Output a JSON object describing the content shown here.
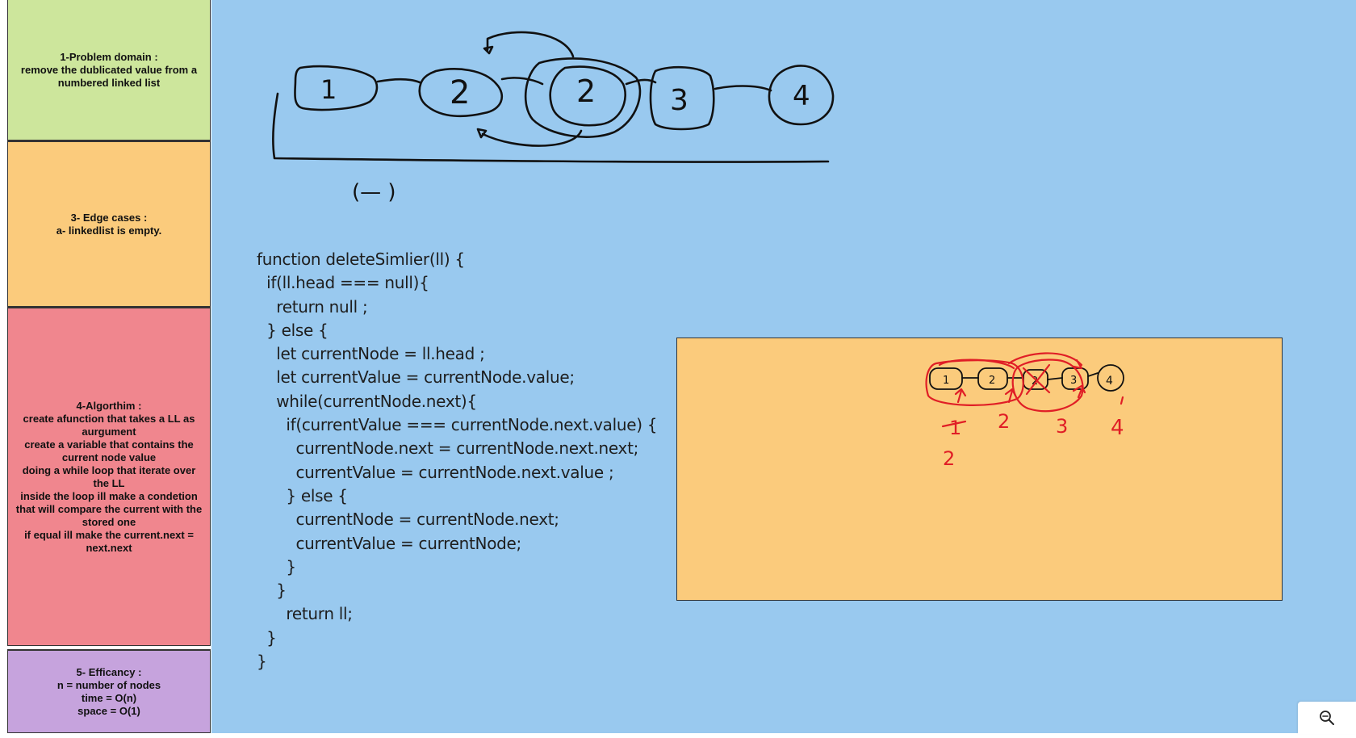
{
  "notes": {
    "problem_domain": "1-Problem domain :\nremove the dublicated value from a numbered linked list",
    "edge_cases": "3- Edge cases :\na- linkedlist is empty.",
    "algorithm": "4-Algorthim :\ncreate afunction that takes a LL as aurgument\ncreate a variable that contains the current node value\ndoing a while loop that iterate over the LL\ninside the loop ill make a condetion that will compare the current with the stored one\nif equal ill make the current.next = next.next",
    "efficiency": "5- Efficancy :\nn = number of nodes\ntime = O(n)\nspace = O(1)"
  },
  "diagram": {
    "nodes": [
      "1",
      "2",
      "2",
      "3",
      "4"
    ],
    "loop_label": "(— )"
  },
  "code": {
    "lines": [
      "function deleteSimlier(ll) {",
      "  if(ll.head === null){",
      "    return null ;",
      "  } else {",
      "    let currentNode = ll.head ;",
      "    let currentValue = currentNode.value;",
      "    while(currentNode.next){",
      "      if(currentValue === currentNode.next.value) {",
      "        currentNode.next = currentNode.next.next;",
      "        currentValue = currentNode.next.value ;",
      "      } else {",
      "        currentNode = currentNode.next;",
      "        currentValue = currentNode;",
      "      }",
      "    }",
      "      return ll;",
      "  }",
      "}"
    ]
  },
  "sketch_frame": {
    "nodes": [
      "1",
      "2",
      "2",
      "3",
      "4"
    ],
    "step_labels": [
      "1",
      "2",
      "3",
      "4"
    ],
    "extra_label": "2"
  },
  "colors": {
    "canvas": "#99c9ef",
    "problem_note": "#cde69c",
    "edge_note": "#fbcb7c",
    "algorithm_note": "#f0868e",
    "efficiency_note": "#c6a3dd",
    "frame": "#fbcb7c",
    "red_ink": "#e01e26"
  },
  "controls": {
    "zoom_icon": "zoom-out-icon"
  }
}
